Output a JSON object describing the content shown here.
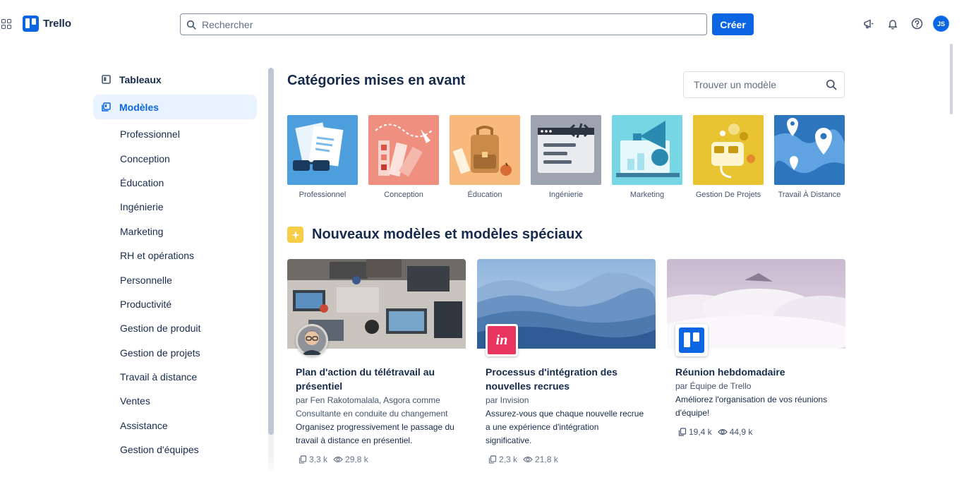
{
  "header": {
    "logo_text": "Trello",
    "search_placeholder": "Rechercher",
    "create_label": "Créer",
    "avatar_initials": "JS"
  },
  "sidebar": {
    "boards_label": "Tableaux",
    "templates_label": "Modèles",
    "items": [
      {
        "label": "Professionnel"
      },
      {
        "label": "Conception"
      },
      {
        "label": "Éducation"
      },
      {
        "label": "Ingénierie"
      },
      {
        "label": "Marketing"
      },
      {
        "label": "RH et opérations"
      },
      {
        "label": "Personnelle"
      },
      {
        "label": "Productivité"
      },
      {
        "label": "Gestion de produit"
      },
      {
        "label": "Gestion de projets"
      },
      {
        "label": "Travail à distance"
      },
      {
        "label": "Ventes"
      },
      {
        "label": "Assistance"
      },
      {
        "label": "Gestion d'équipes"
      }
    ]
  },
  "main": {
    "featured_title": "Catégories mises en avant",
    "find_template_placeholder": "Trouver un modèle",
    "categories": [
      {
        "label": "Professionnel",
        "color": "#4c9fdc"
      },
      {
        "label": "Conception",
        "color": "#ef8f80"
      },
      {
        "label": "Éducation",
        "color": "#f8b97c"
      },
      {
        "label": "Ingénierie",
        "color": "#9ea4af"
      },
      {
        "label": "Marketing",
        "color": "#76d6e3"
      },
      {
        "label": "Gestion De Projets",
        "color": "#e8c332"
      },
      {
        "label": "Travail À Distance",
        "color": "#2d75bd"
      }
    ],
    "new_section_title": "Nouveaux modèles et modèles spéciaux",
    "cards": [
      {
        "title": "Plan d'action du télétravail au présentiel",
        "author": "par Fen Rakotomalala, Asgora comme Consultante en conduite du changement",
        "description": "Organisez progressivement le passage du travail à distance en présentiel.",
        "copies": "3,3 k",
        "views": "29,8 k"
      },
      {
        "title": "Processus d'intégration des nouvelles recrues",
        "author": "par Invision",
        "description": "Assurez-vous que chaque nouvelle recrue a une expérience d'intégration significative.",
        "copies": "2,3 k",
        "views": "21,8 k",
        "badge_text": "in"
      },
      {
        "title": "Réunion hebdomadaire",
        "author": "par Équipe de Trello",
        "description": "Améliorez l'organisation de vos réunions d'équipe!",
        "copies": "19,4 k",
        "views": "44,9 k"
      }
    ]
  },
  "colors": {
    "brand": "#0c66e4",
    "active_bg": "#e9f2ff",
    "text": "#172b4d",
    "subtle": "#44546f",
    "invision": "#e8345e"
  }
}
